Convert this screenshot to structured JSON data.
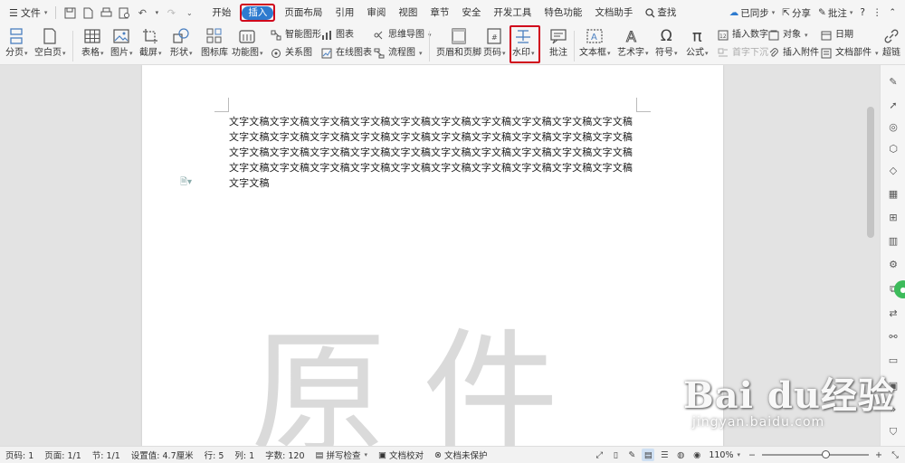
{
  "menubar": {
    "file_label": "文件",
    "tabs": [
      "开始",
      "插入",
      "页面布局",
      "引用",
      "审阅",
      "视图",
      "章节",
      "安全",
      "开发工具",
      "特色功能",
      "文档助手"
    ],
    "active_tab": "插入",
    "search_label": "查找",
    "sync_label": "已同步",
    "share_label": "分享",
    "comment_label": "批注",
    "help_label": "?"
  },
  "ribbon": {
    "page_break": "分页",
    "blank_page": "空白页",
    "table": "表格",
    "picture": "图片",
    "screenshot": "截屏",
    "shapes": "形状",
    "icon_lib": "图标库",
    "func_chart": "功能图",
    "smart_graphic": "智能图形",
    "chart": "图表",
    "mind_map": "思维导图",
    "relation": "关系图",
    "online_chart": "在线图表",
    "flowchart": "流程图",
    "header_footer": "页眉和页脚",
    "page_number": "页码",
    "watermark": "水印",
    "annotation": "批注",
    "textbox": "文本框",
    "wordart": "艺术字",
    "symbol": "符号",
    "formula": "公式",
    "insert_number": "插入数字",
    "object": "对象",
    "date": "日期",
    "drop_cap": "首字下沉",
    "attachment": "插入附件",
    "doc_parts": "文档部件",
    "super_link": "超链"
  },
  "document": {
    "body_text": "文字文稿文字文稿文字文稿文字文稿文字文稿文字文稿文字文稿文字文稿文字文稿文字文稿文字文稿文字文稿文字文稿文字文稿文字文稿文字文稿文字文稿文字文稿文字文稿文字文稿文字文稿文字文稿文字文稿文字文稿文字文稿文字文稿文字文稿文字文稿文字文稿文字文稿文字文稿文字文稿文字文稿文字文稿文字文稿文字文稿文字文稿文字文稿文字文稿文字文稿文字文稿",
    "watermark_text": "原件"
  },
  "statusbar": {
    "page_num": "页码: 1",
    "pages": "页面: 1/1",
    "section": "节: 1/1",
    "setting": "设置值: 4.7厘米",
    "row": "行: 5",
    "col": "列: 1",
    "word_count": "字数: 120",
    "spell_check": "拼写检查",
    "doc_proof": "文档校对",
    "protect": "文档未保护",
    "zoom": "110%",
    "zoom_level_percent": 110
  },
  "baidu": {
    "logo": "Bai du经验",
    "url": "jingyan.baidu.com"
  },
  "colors": {
    "accent": "#2e7bcf",
    "highlight": "#d0021b",
    "green": "#3dbb5b"
  }
}
